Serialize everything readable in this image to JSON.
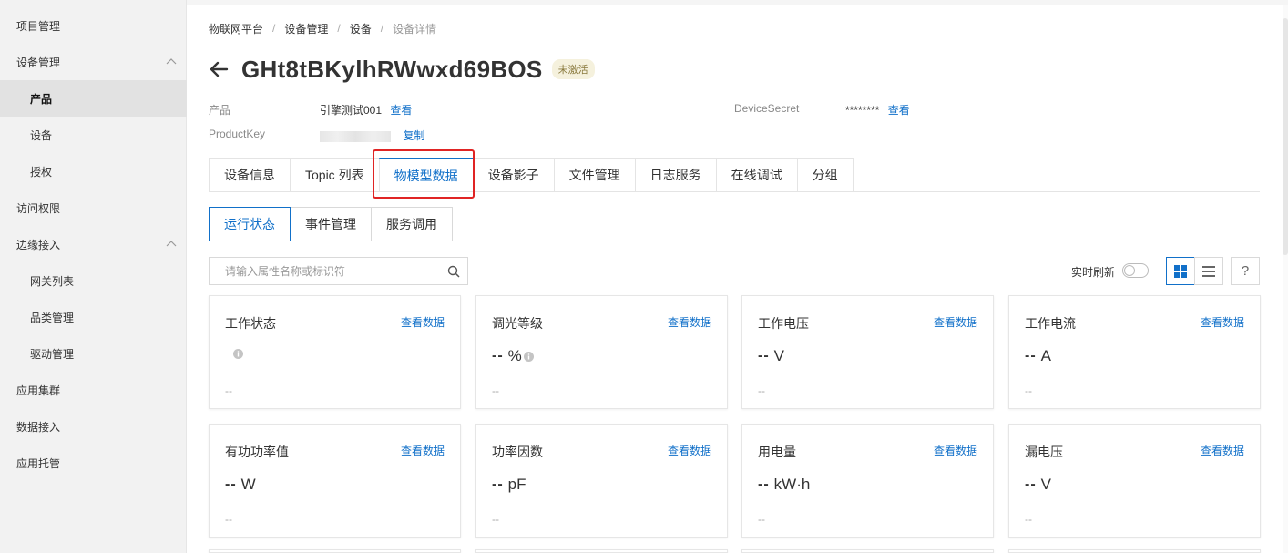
{
  "sidebar": {
    "items": [
      {
        "label": "项目管理",
        "level": 1
      },
      {
        "label": "设备管理",
        "level": 1,
        "expanded": true
      },
      {
        "label": "产品",
        "level": 2,
        "active": true
      },
      {
        "label": "设备",
        "level": 2
      },
      {
        "label": "授权",
        "level": 2
      },
      {
        "label": "访问权限",
        "level": 1
      },
      {
        "label": "边缘接入",
        "level": 1,
        "expanded": true
      },
      {
        "label": "网关列表",
        "level": 2
      },
      {
        "label": "品类管理",
        "level": 2
      },
      {
        "label": "驱动管理",
        "level": 2
      },
      {
        "label": "应用集群",
        "level": 1
      },
      {
        "label": "数据接入",
        "level": 1
      },
      {
        "label": "应用托管",
        "level": 1
      }
    ]
  },
  "breadcrumb": {
    "items": [
      "物联网平台",
      "设备管理",
      "设备",
      "设备详情"
    ],
    "separator": "/"
  },
  "header": {
    "title": "GHt8tBKylhRWwxd69BOS",
    "status": "未激活"
  },
  "meta": {
    "product_label": "产品",
    "product_value": "引擎测试001",
    "product_link": "查看",
    "productkey_label": "ProductKey",
    "productkey_link": "复制",
    "secret_label": "DeviceSecret",
    "secret_value": "********",
    "secret_link": "查看"
  },
  "tabs": [
    "设备信息",
    "Topic 列表",
    "物模型数据",
    "设备影子",
    "文件管理",
    "日志服务",
    "在线调试",
    "分组"
  ],
  "active_tab": 2,
  "subtabs": [
    "运行状态",
    "事件管理",
    "服务调用"
  ],
  "active_subtab": 0,
  "search": {
    "placeholder": "请输入属性名称或标识符"
  },
  "toolbar": {
    "refresh_label": "实时刷新",
    "refresh_on": false,
    "help": "?"
  },
  "cards": [
    {
      "name": "工作状态",
      "link": "查看数据",
      "dash": "",
      "unit": "",
      "info": true,
      "sub": "--"
    },
    {
      "name": "调光等级",
      "link": "查看数据",
      "dash": "--",
      "unit": "%",
      "info": true,
      "sub": "--"
    },
    {
      "name": "工作电压",
      "link": "查看数据",
      "dash": "--",
      "unit": "V",
      "info": false,
      "sub": "--"
    },
    {
      "name": "工作电流",
      "link": "查看数据",
      "dash": "--",
      "unit": "A",
      "info": false,
      "sub": "--"
    },
    {
      "name": "有功功率值",
      "link": "查看数据",
      "dash": "--",
      "unit": "W",
      "info": false,
      "sub": "--"
    },
    {
      "name": "功率因数",
      "link": "查看数据",
      "dash": "--",
      "unit": "pF",
      "info": false,
      "sub": "--"
    },
    {
      "name": "用电量",
      "link": "查看数据",
      "dash": "--",
      "unit": "kW·h",
      "info": false,
      "sub": "--"
    },
    {
      "name": "漏电压",
      "link": "查看数据",
      "dash": "--",
      "unit": "V",
      "info": false,
      "sub": "--"
    }
  ],
  "colors": {
    "accent": "#1170c9",
    "highlight": "#e02424",
    "sidebar_bg": "#f2f2f2"
  }
}
